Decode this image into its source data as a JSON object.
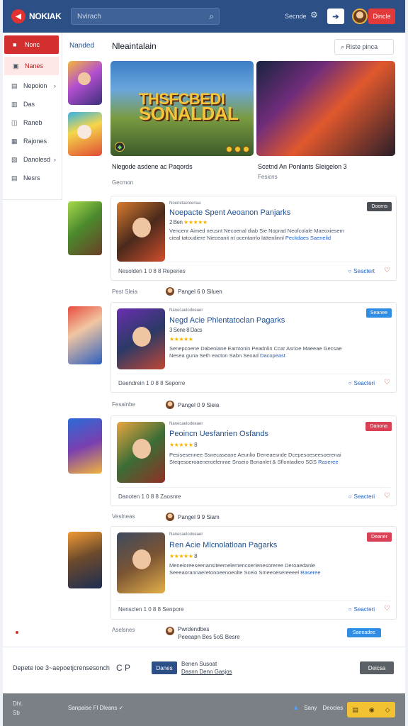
{
  "header": {
    "logo_glyph": "◀",
    "brand": "NOKIAK",
    "search_placeholder": "Nvirach",
    "search_icon": "search-icon",
    "link": "Secnde",
    "profile_btn": "➔",
    "cta": "Dincle",
    "accent": "#2c4f86",
    "cta_color": "#e23a3a"
  },
  "sidebar": {
    "items": [
      {
        "label": "Nonc",
        "icon": "■"
      },
      {
        "label": "Nanes",
        "icon": "▣"
      },
      {
        "label": "Nepoion",
        "icon": "▤"
      },
      {
        "label": "Das",
        "icon": "▥"
      },
      {
        "label": "Raneb",
        "icon": "◫"
      },
      {
        "label": "Rajones",
        "icon": "▦"
      },
      {
        "label": "Danolesd",
        "icon": "▧"
      },
      {
        "label": "Nesrs",
        "icon": "▤"
      }
    ]
  },
  "section": {
    "tag": "Nanded",
    "title": "Nleaintalain",
    "filter": "Riste pinca"
  },
  "hero": {
    "wordmark_line1": "THSFCBEDI",
    "wordmark_line2": "SONALDAL",
    "caption_left": "Nlegode asdene ac Paqords",
    "sub_left": "Gecmon",
    "caption_right": "Scetnd An Ponlants Sleigelon 3",
    "sub_right": "Fesicns"
  },
  "cards": [
    {
      "meta": "Noenetaetoeriaa",
      "title": "Noepacte Spent Aeoanon Panjarks",
      "rating_stars": "★★★★★",
      "rating_text": "2 Ben",
      "desc": "Vencenr Aimed neusnt Necoenal diab Sie Noprad Neofcolale Maeoxiesem cieal tatoudiere Nieceanit nt ocentarrlo lattenlinnl",
      "desc_link": "Peckdaes Saenelid",
      "badge": "Doorns",
      "badge_color": "#4b4f56",
      "footer_left": "Nesolden 1 0 8 8 Repenes",
      "action": "Seactert",
      "byline": "Pest Sleia",
      "author": "Pangel 6 0 Siluen"
    },
    {
      "meta": "Nanecaelodoeaer",
      "title": "Negd Acie Phlentatoclan Pagarks",
      "rating_stars": "★★★★★",
      "rating_text": "3 Sene 8 Dacs",
      "desc": "Senepcoene Dabeniane Eamtonin Peadnlin Ccar Asrioe Maeeae Gecsae Nesea guna Seth eacton Sabn Seoad",
      "desc_link": "Dacopeast",
      "badge": "Seanee",
      "badge_color": "#2f8de4",
      "footer_left": "Daendrein 1 0 8 8 Seporre",
      "action": "Seacteri",
      "byline": "Fesalnbe",
      "author": "Pangel 0 9 Sieia"
    },
    {
      "meta": "Nanecaelodoeaer",
      "title": "Peoincn Uesfanrien Osfands",
      "rating_stars": "★★★★★",
      "rating_text": "8",
      "desc": "Pesisesennee Ssnecaseane Aeunlio Deneaesnde Dcepesoeseesoerenai Steqesoeroaeneroelenrae Snseio Bonanlet & Sflontadieo SGS",
      "desc_link": "Raseree",
      "badge": "Danona",
      "badge_color": "#d94256",
      "footer_left": "Danoten 1 0 8 8 Zaosnre",
      "action": "Seacteri",
      "byline": "Veslneas",
      "author": "Pangel 9 9 Siam"
    },
    {
      "meta": "Nanecaelodoeaer",
      "title": "Ren Acie Mlcnolatloan Pagarks",
      "rating_stars": "★★★★★",
      "rating_text": "8",
      "desc": "Meneloreeseenansiteemelemencoerlenesoreree Deroaedanle Seeeaorannaeretonoeenoeolte Sceio Smeeoesereeeel",
      "desc_link": "Raseree",
      "badge": "Deaner",
      "badge_color": "#d94256",
      "footer_left": "Nensclen 1 0 8 8 Senpore",
      "action": "Seacteri",
      "byline": "Aselsnes",
      "author_name": "Pwrdendbes",
      "author": "Peeeapn Bes 5oS Besre",
      "author_badge": "Saeeadee",
      "author_badge_color": "#2f8de4"
    }
  ],
  "strip": {
    "text": "Depete loe  3~aepoetjcrensesonch",
    "icon": "C  P",
    "button": "Danes",
    "info_line1": "Benen Susoat",
    "info_line2": "Dasnn Denn Gasjos",
    "dark_button": "Deicsa"
  },
  "footer": {
    "left_line1": "Dhl.",
    "left_line2": "Sb",
    "menu": "Sanpaise   Fl  Dleans ✓",
    "share_label": "Sany",
    "share_label2": "Deocies",
    "yellow_icons": [
      "▤",
      "◉",
      "◇"
    ]
  }
}
